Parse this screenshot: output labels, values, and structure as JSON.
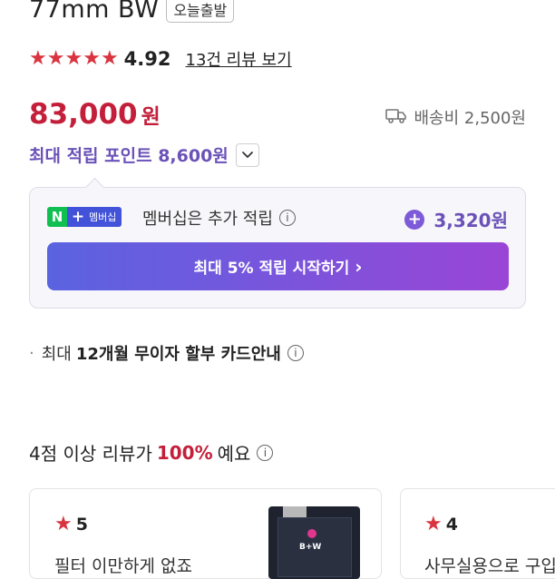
{
  "product": {
    "title": "77mm BW",
    "badge": "오늘출발"
  },
  "rating": {
    "stars": 5,
    "score": "4.92",
    "review_link": "13건 리뷰 보기"
  },
  "price": {
    "amount": "83,000",
    "unit": "원"
  },
  "shipping": {
    "label": "배송비 2,500원",
    "icon": "truck-icon"
  },
  "points": {
    "label": "최대 적립 포인트 8,600원"
  },
  "membership": {
    "badge_n": "N",
    "badge_plus": "+",
    "badge_label": "멤버십",
    "text": "멤버십은 추가 적립",
    "points": "3,320원",
    "button": "최대 5% 적립 시작하기",
    "button_chevron": "›",
    "accent": "#6b52b8"
  },
  "installment": {
    "prefix": "최대",
    "text": "12개월 무이자 할부 카드안내"
  },
  "review_summary": {
    "prefix": "4점 이상 리뷰가",
    "percent": "100%",
    "suffix": "예요"
  },
  "reviews": [
    {
      "score": "5",
      "text": "필터 이만하게 없죠"
    },
    {
      "score": "4",
      "text": "사무실용으로 구입"
    }
  ],
  "thumbnail": {
    "logo_text": "B+W"
  },
  "colors": {
    "price_red": "#c41f3a",
    "star_red": "#d9343f",
    "purple": "#6b52b8"
  }
}
